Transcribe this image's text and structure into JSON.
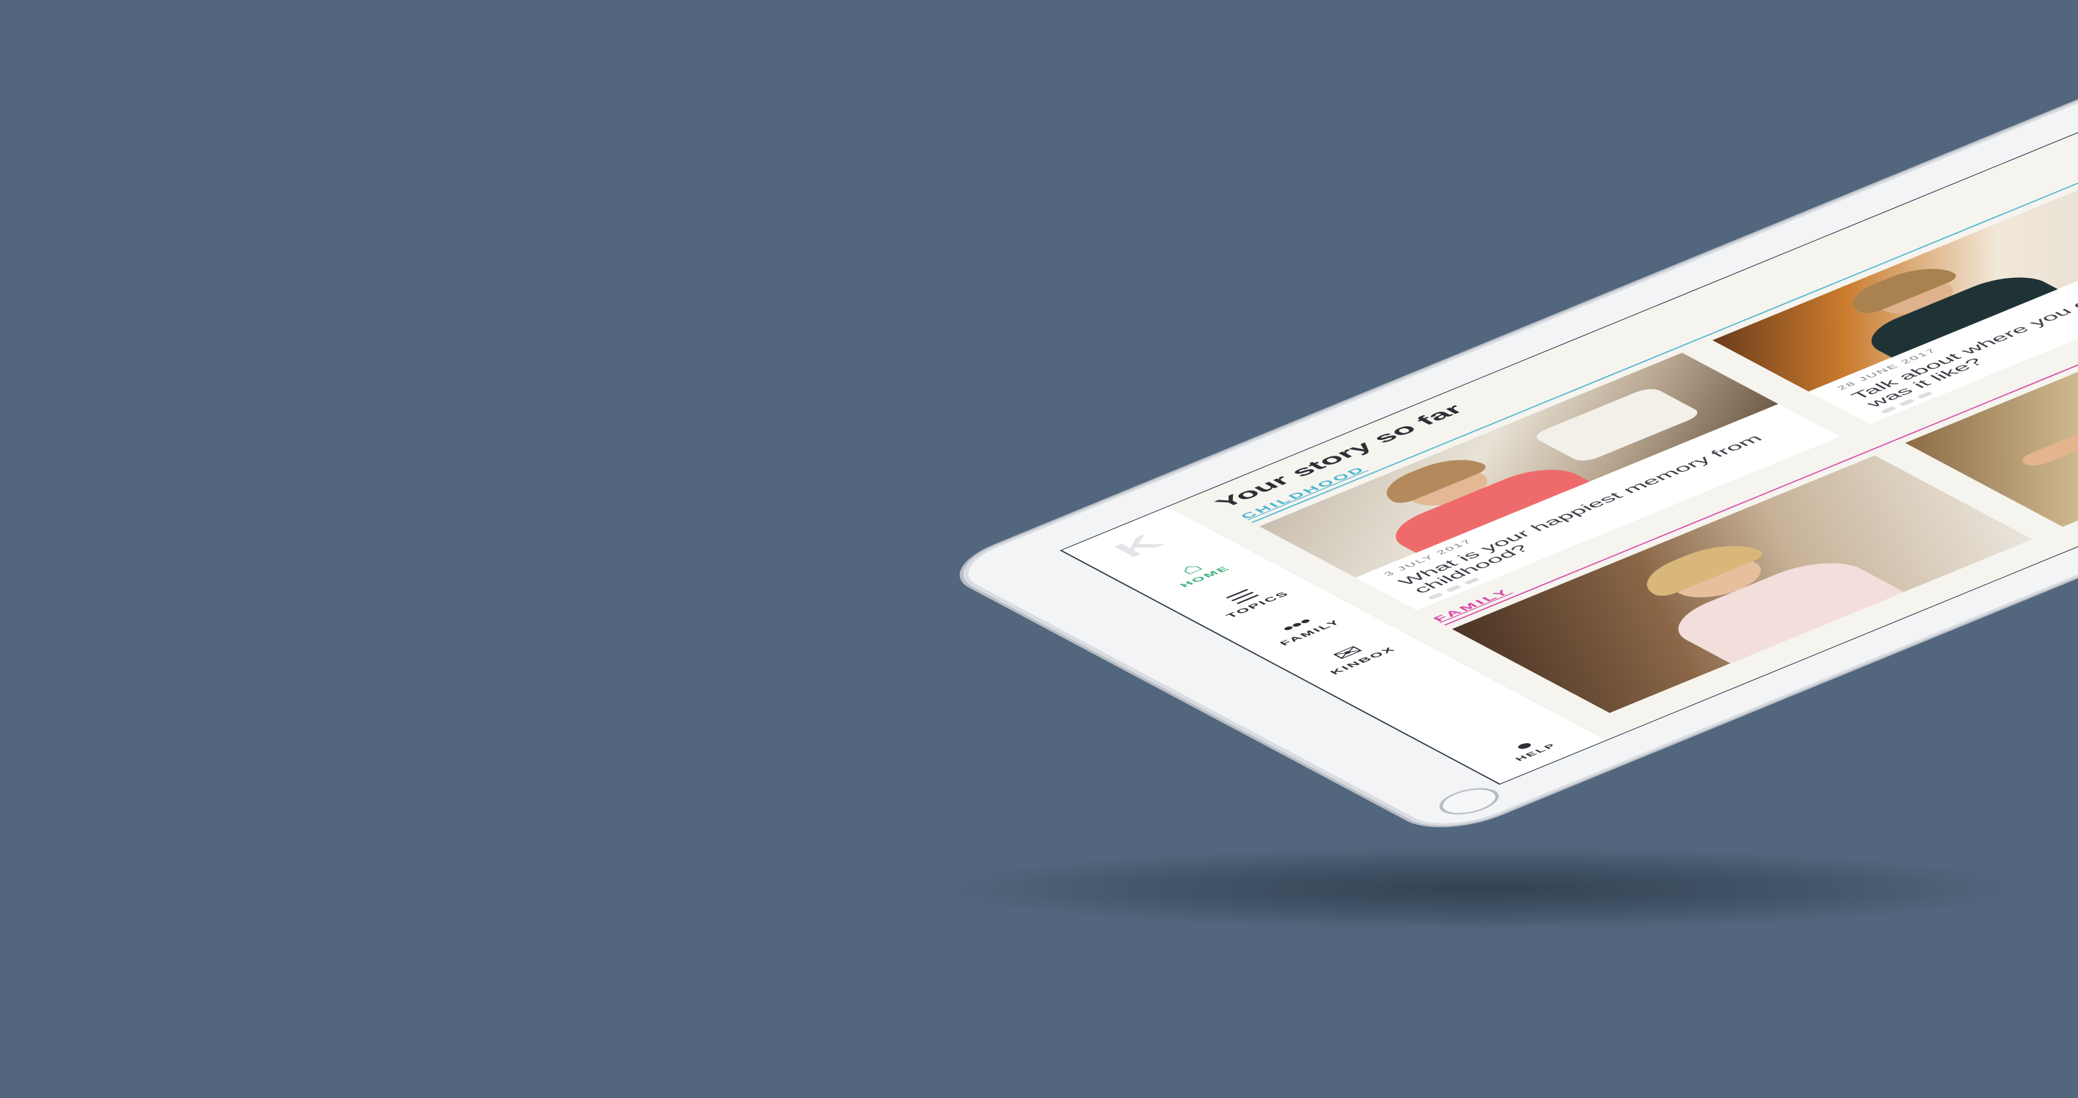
{
  "app": {
    "logo_letter": "K",
    "page_title": "Your story so far"
  },
  "sidebar": {
    "items": [
      {
        "label": "HOME",
        "icon": "home-icon",
        "glyph": "⌂"
      },
      {
        "label": "TOPICS",
        "icon": "list-icon",
        "glyph": "☰"
      },
      {
        "label": "FAMILY",
        "icon": "family-icon",
        "glyph": "●●●"
      },
      {
        "label": "KINBOX",
        "icon": "envelope-icon",
        "glyph": "✉"
      }
    ],
    "help": {
      "label": "HELP",
      "icon": "chat-bubble-icon",
      "glyph": "●"
    }
  },
  "sections": [
    {
      "label": "CHILDHOOD",
      "color": "#4bb6d0"
    },
    {
      "label": "FAMILY",
      "color": "#d84aa8"
    }
  ],
  "cards": [
    {
      "date": "3 JULY 2017",
      "question": "What is your happiest memory from childhood?"
    },
    {
      "date": "28 JUNE 2017",
      "question": "Talk about where you grew up - what was it like?"
    },
    {
      "date": "",
      "question": ""
    },
    {
      "date": "",
      "question": ""
    }
  ],
  "colors": {
    "background": "#52677e",
    "accent_active": "#3fb27f",
    "childhood": "#4bb6d0",
    "family": "#d84aa8"
  }
}
